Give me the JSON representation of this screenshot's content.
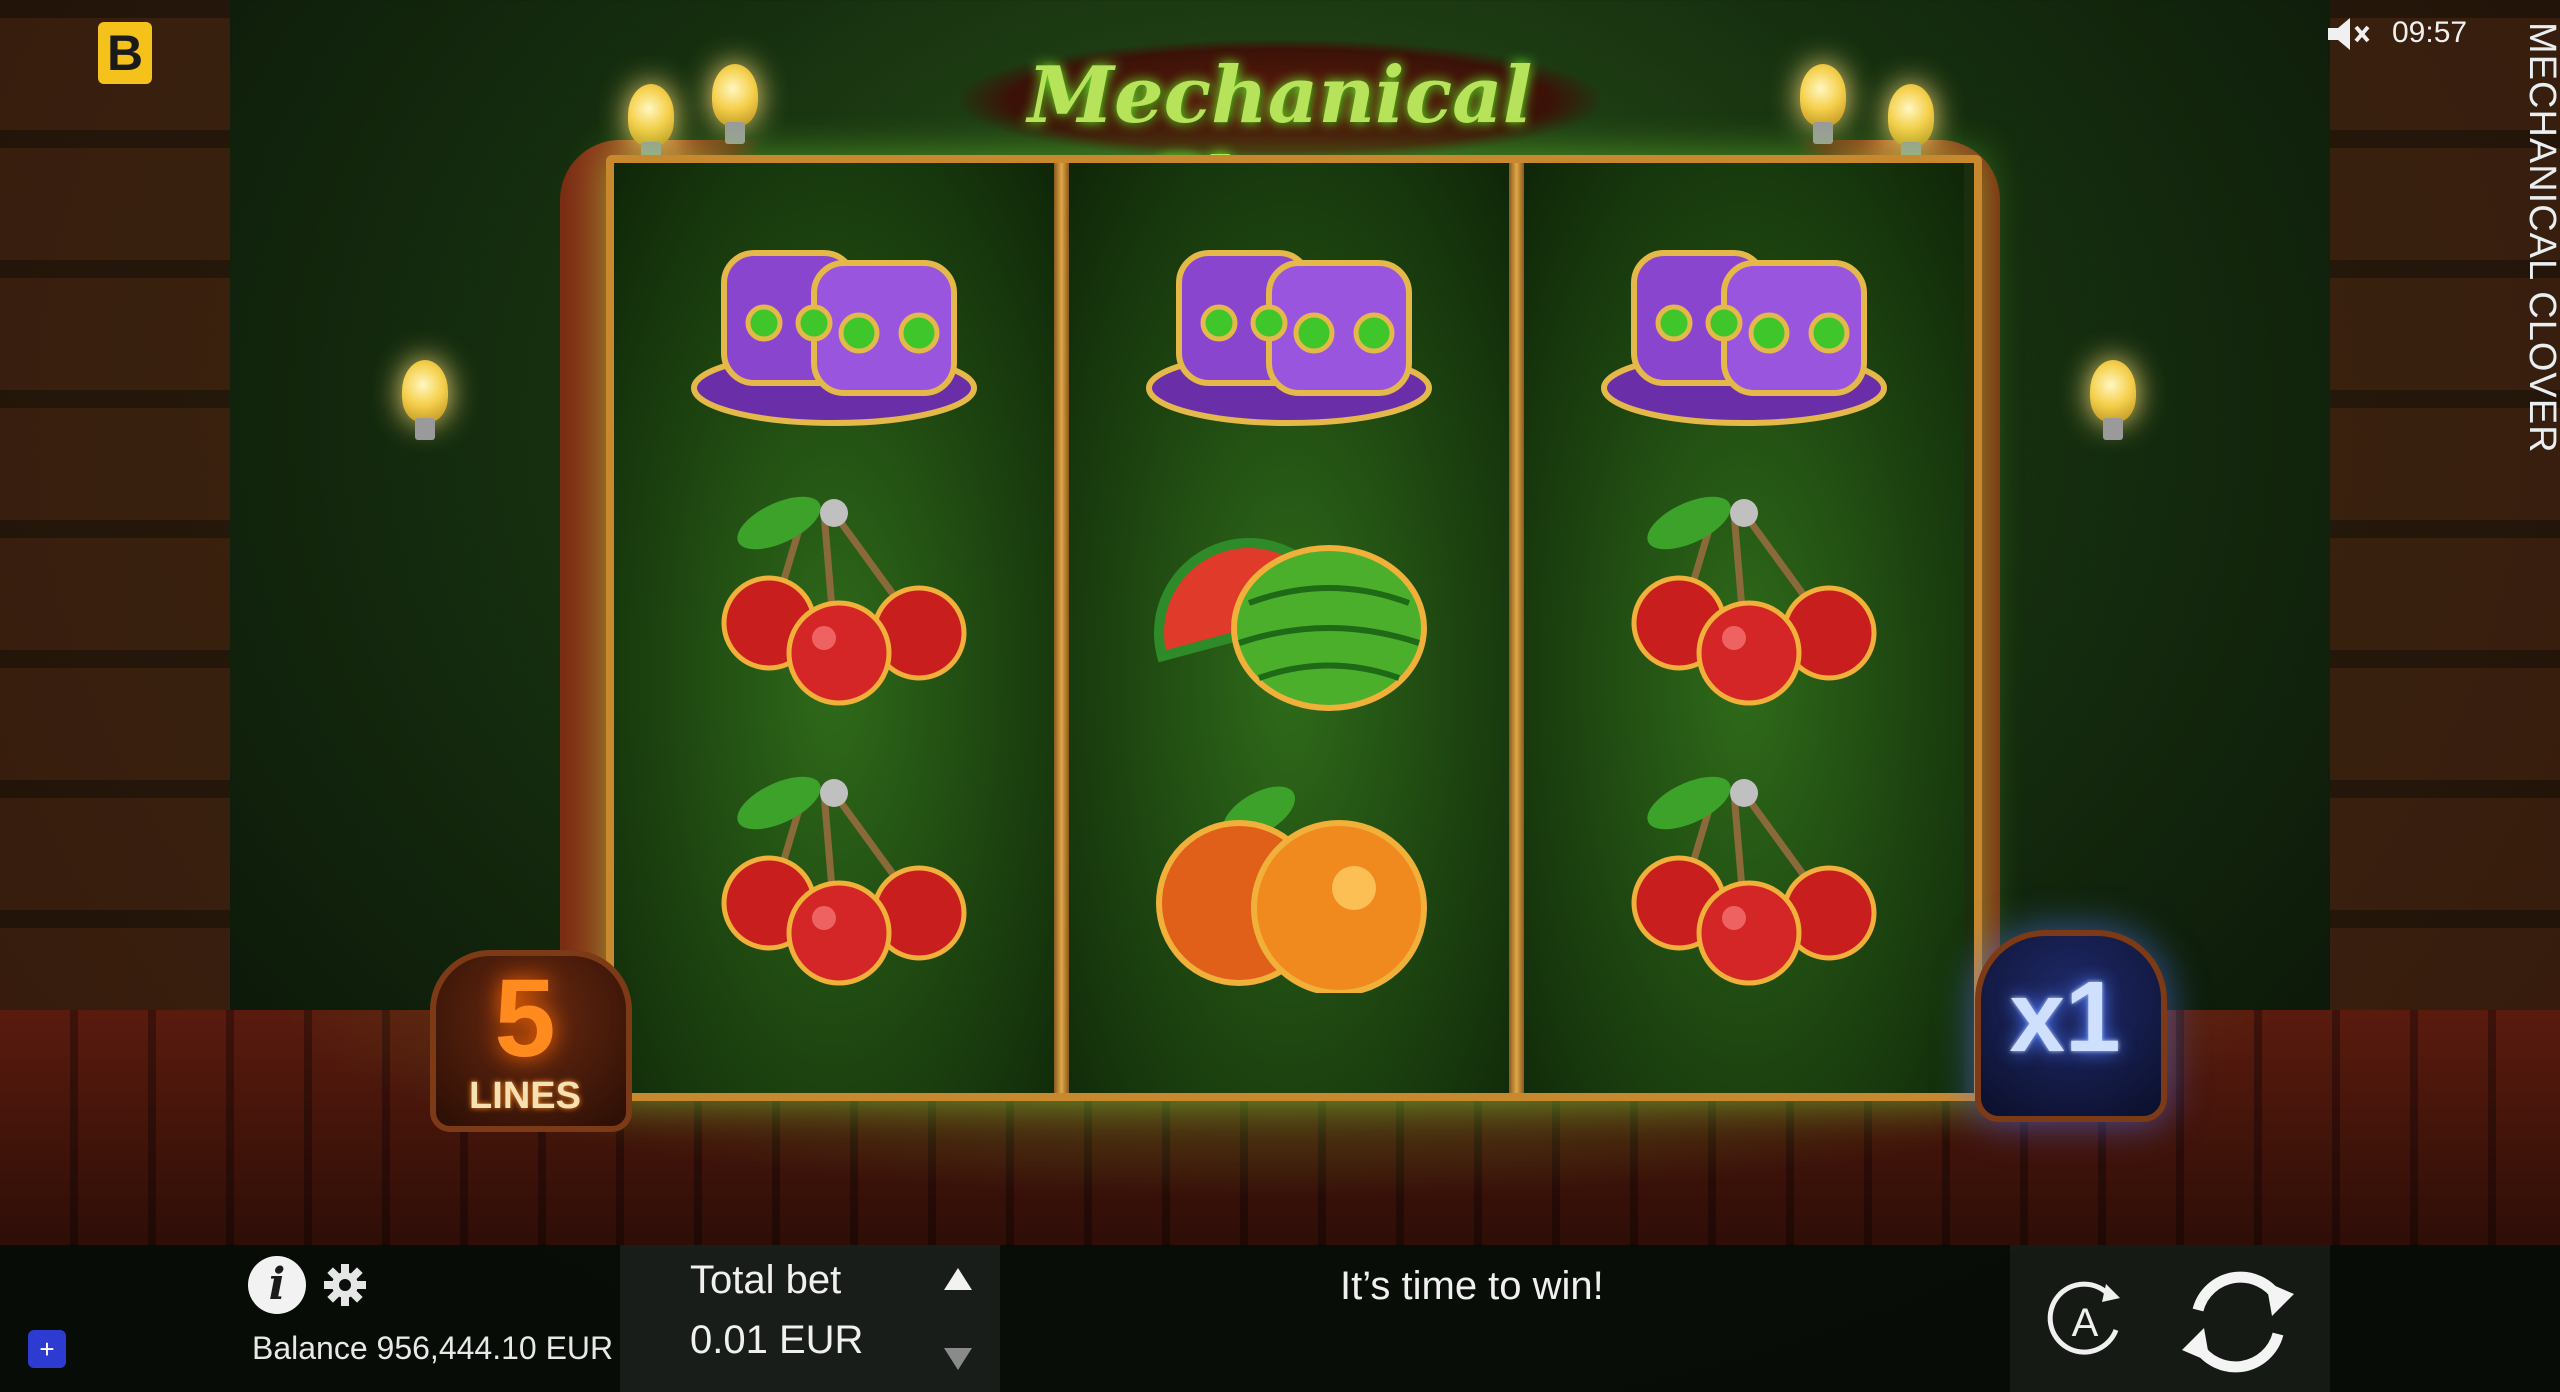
{
  "game": {
    "title": "Mechanical Clover",
    "vertical_title": "MECHANICAL CLOVER",
    "logo_letter": "B"
  },
  "status": {
    "clock": "09:57",
    "sound_icon": "speaker-muted-icon"
  },
  "reels": [
    [
      "top-hat",
      "cherries",
      "cherries"
    ],
    [
      "top-hat",
      "watermelon",
      "orange"
    ],
    [
      "top-hat",
      "cherries",
      "cherries"
    ]
  ],
  "badges": {
    "lines_number": "5",
    "lines_label": "LINES",
    "multiplier": "x1"
  },
  "bottom_bar": {
    "info_label": "i",
    "balance": "Balance 956,444.10 EUR",
    "bet_label": "Total bet",
    "bet_value": "0.01 EUR",
    "message": "It’s time to win!",
    "plus_label": "+",
    "auto_label": "A"
  },
  "colors": {
    "background": "#16300f",
    "reel_glow": "#6cff2c",
    "frame_gold": "#c8882e",
    "lines_orange": "#ff8a1e",
    "multiplier_blue": "#4f7dff",
    "bar_bg": "#080c08"
  }
}
